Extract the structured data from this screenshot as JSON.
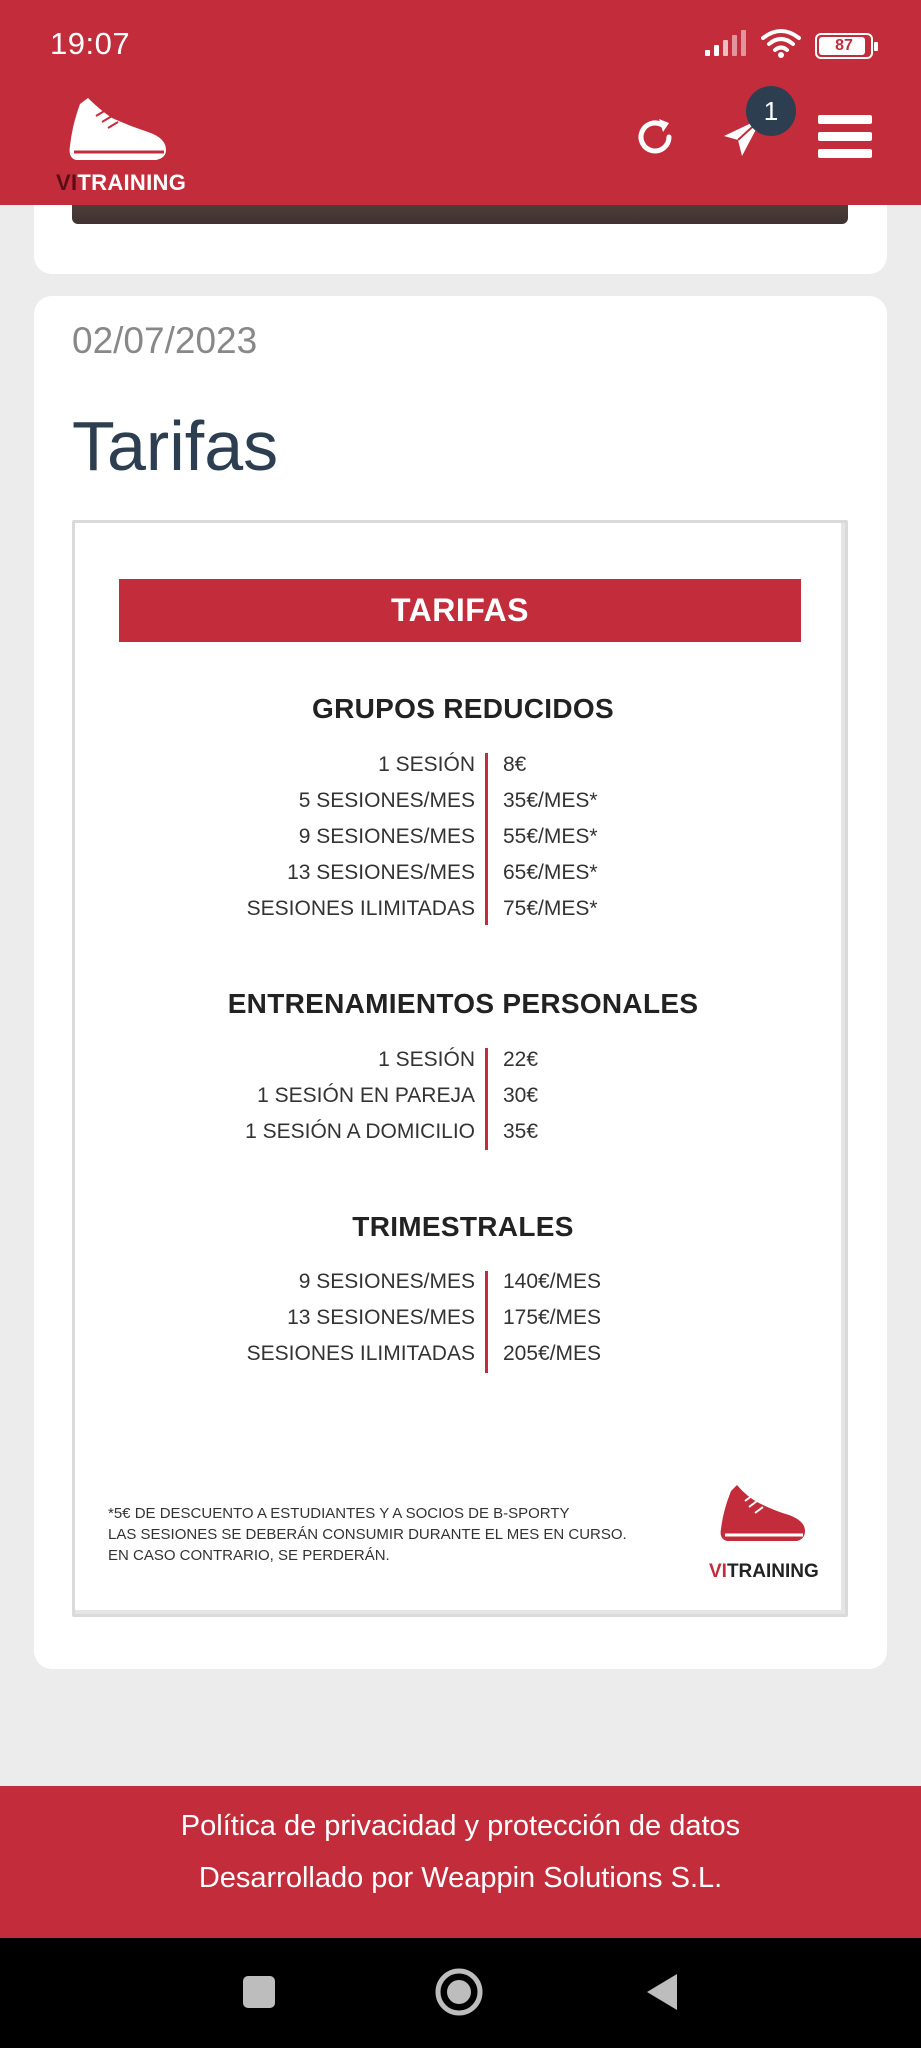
{
  "status_bar": {
    "time": "19:07",
    "battery": "87"
  },
  "app_bar": {
    "logo": {
      "prefix": "VI",
      "suffix": "TRAINING"
    },
    "notification_count": "1",
    "colors": {
      "brand": "#c22c3b",
      "badge": "#2c3e50"
    }
  },
  "post": {
    "date": "02/07/2023",
    "title": "Tarifas"
  },
  "flyer": {
    "banner": "TARIFAS",
    "sections": [
      {
        "title": "GRUPOS REDUCIDOS",
        "rows": [
          {
            "label": "1 SESIÓN",
            "price": "8€"
          },
          {
            "label": "5 SESIONES/MES",
            "price": "35€/MES*"
          },
          {
            "label": "9 SESIONES/MES",
            "price": "55€/MES*"
          },
          {
            "label": "13 SESIONES/MES",
            "price": "65€/MES*"
          },
          {
            "label": "SESIONES ILIMITADAS",
            "price": "75€/MES*"
          }
        ]
      },
      {
        "title": "ENTRENAMIENTOS PERSONALES",
        "rows": [
          {
            "label": "1 SESIÓN",
            "price": "22€"
          },
          {
            "label": "1 SESIÓN EN PAREJA",
            "price": "30€"
          },
          {
            "label": "1 SESIÓN A DOMICILIO",
            "price": "35€"
          }
        ]
      },
      {
        "title": "TRIMESTRALES",
        "rows": [
          {
            "label": "9 SESIONES/MES",
            "price": "140€/MES"
          },
          {
            "label": "13 SESIONES/MES",
            "price": "175€/MES"
          },
          {
            "label": "SESIONES ILIMITADAS",
            "price": "205€/MES"
          }
        ]
      }
    ],
    "notes": [
      "*5€ DE DESCUENTO A ESTUDIANTES Y A SOCIOS DE B-SPORTY",
      "LAS SESIONES SE DEBERÁN CONSUMIR DURANTE EL MES EN CURSO.",
      "EN CASO CONTRARIO, SE PERDERÁN."
    ],
    "logo": {
      "prefix": "VI",
      "suffix": "TRAINING"
    }
  },
  "footer": {
    "privacy_link": "Política de privacidad y protección de datos",
    "developer_link": "Desarrollado por Weappin Solutions S.L."
  }
}
